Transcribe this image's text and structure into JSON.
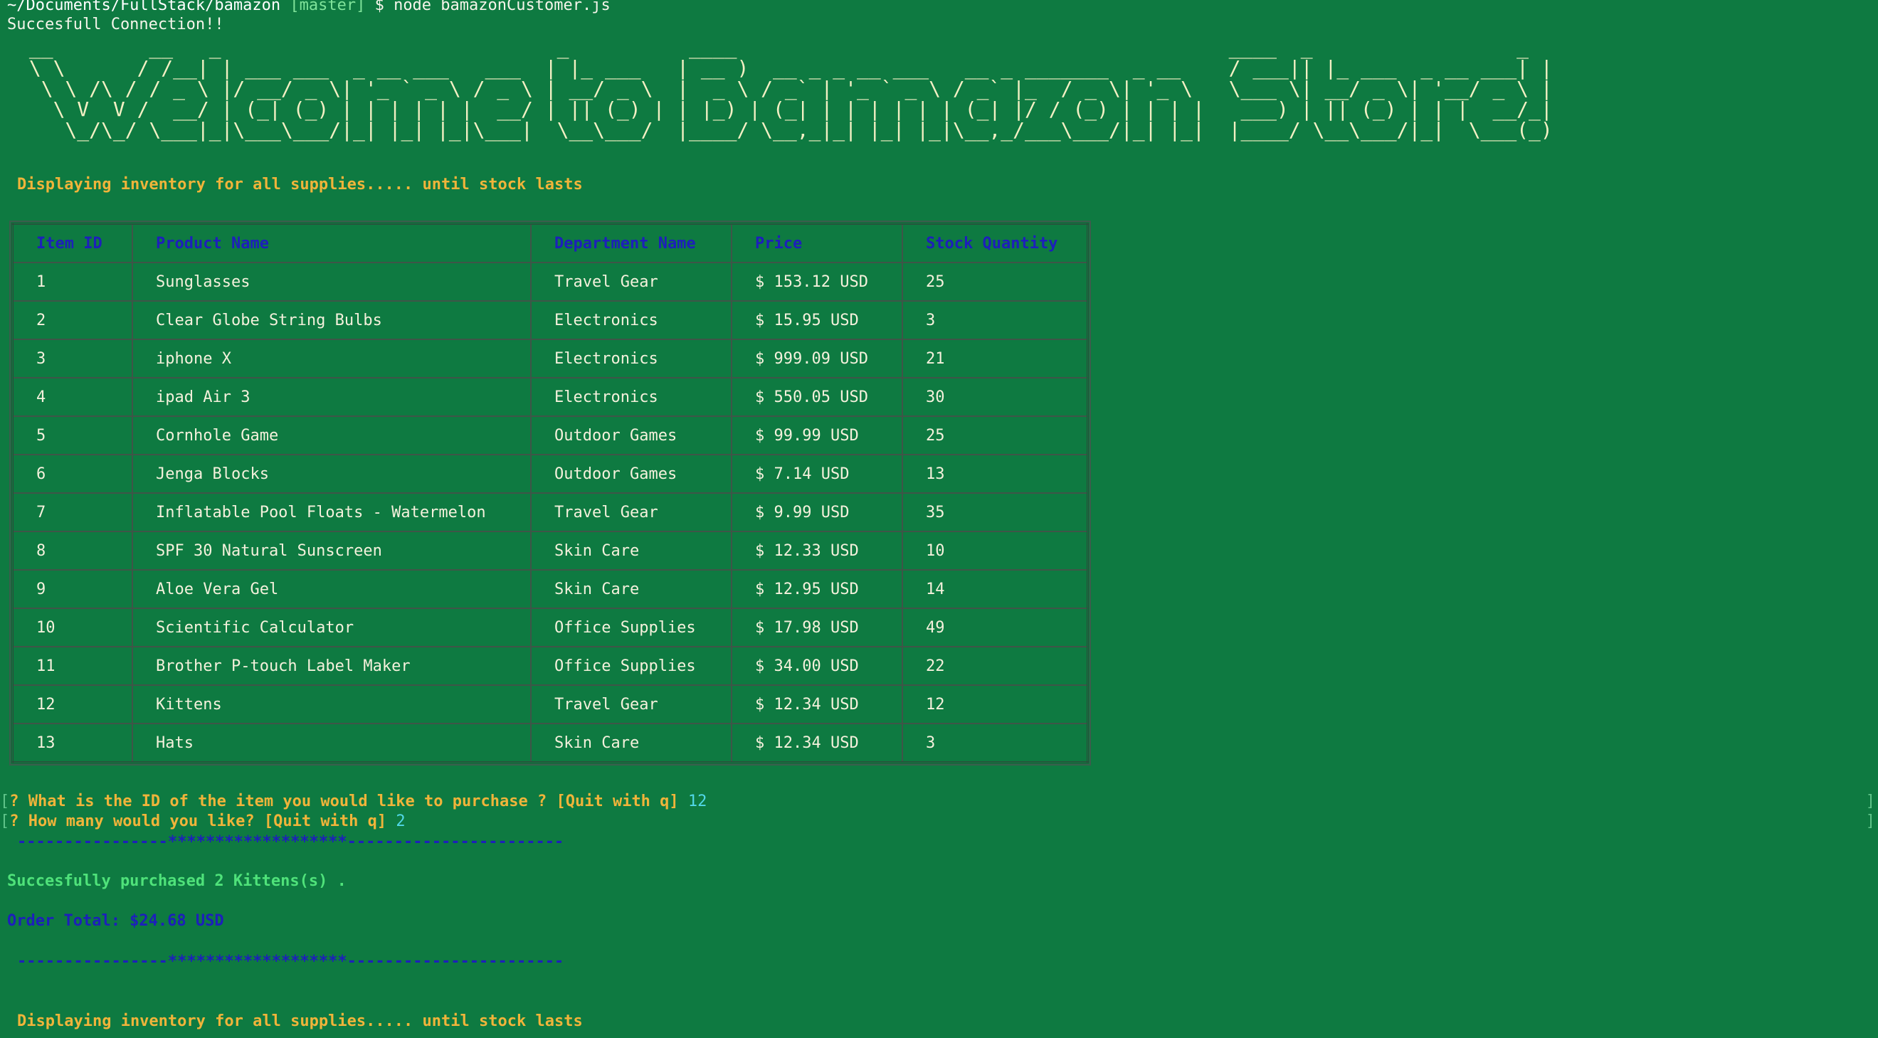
{
  "terminal": {
    "prompt_path": "~/Documents/FullStack/bamazon",
    "prompt_branch": "[master]",
    "prompt_command": "$ node bamazonCustomer.js",
    "connection_message": "Succesfull Connection!!",
    "banner_text": "Welcome to Bamazon Store!",
    "inventory_message": "Displaying inventory for all supplies..... until stock lasts",
    "table": {
      "headers": [
        "Item ID",
        "Product Name",
        "Department Name",
        "Price",
        "Stock Quantity"
      ],
      "rows": [
        [
          "1",
          "Sunglasses",
          "Travel Gear",
          "$ 153.12 USD",
          "25"
        ],
        [
          "2",
          "Clear Globe String Bulbs",
          "Electronics",
          "$ 15.95 USD",
          "3"
        ],
        [
          "3",
          "iphone X",
          "Electronics",
          "$ 999.09 USD",
          "21"
        ],
        [
          "4",
          "ipad Air 3",
          "Electronics",
          "$ 550.05 USD",
          "30"
        ],
        [
          "5",
          "Cornhole Game",
          "Outdoor Games",
          "$ 99.99 USD",
          "25"
        ],
        [
          "6",
          "Jenga Blocks",
          "Outdoor Games",
          "$ 7.14 USD",
          "13"
        ],
        [
          "7",
          "Inflatable Pool Floats - Watermelon",
          "Travel Gear",
          "$ 9.99 USD",
          "35"
        ],
        [
          "8",
          "SPF 30 Natural Sunscreen",
          "Skin Care",
          "$ 12.33 USD",
          "10"
        ],
        [
          "9",
          "Aloe Vera Gel",
          "Skin Care",
          "$ 12.95 USD",
          "14"
        ],
        [
          "10",
          "Scientific Calculator",
          "Office Supplies",
          "$ 17.98 USD",
          "49"
        ],
        [
          "11",
          "Brother P-touch Label Maker",
          "Office Supplies",
          "$ 34.00 USD",
          "22"
        ],
        [
          "12",
          "Kittens",
          "Travel Gear",
          "$ 12.34 USD",
          "12"
        ],
        [
          "13",
          "Hats",
          "Skin Care",
          "$ 12.34 USD",
          "3"
        ]
      ]
    },
    "question1": {
      "mark": "?",
      "text": "What is the ID of the item you would like to purchase ? [Quit with q]",
      "answer": "12"
    },
    "question2": {
      "mark": "?",
      "text": "How many would you like? [Quit with q]",
      "answer": "2"
    },
    "separator": "----------------*******************-----------------------",
    "purchase_message": "Succesfully purchased 2 Kittens(s) .",
    "order_total": "Order Total: $24.68 USD",
    "inventory_message_2": "Displaying inventory for all supplies..... until stock lasts"
  }
}
